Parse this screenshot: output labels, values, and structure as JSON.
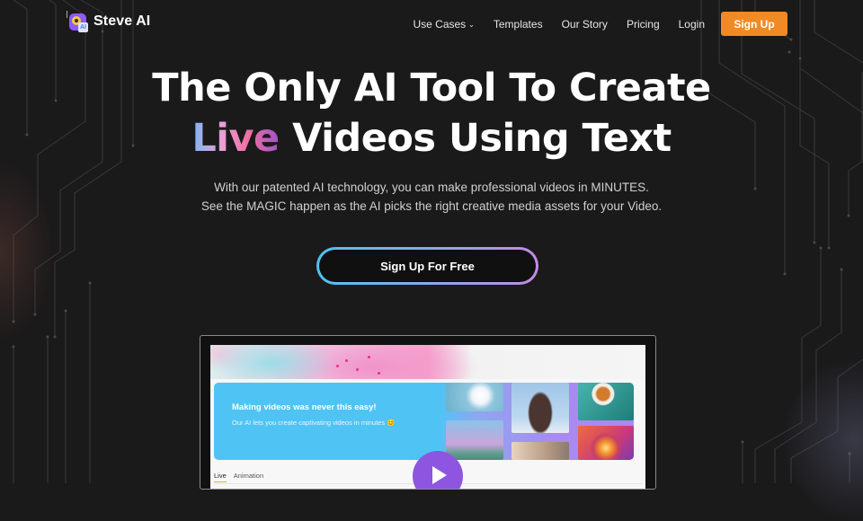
{
  "brand": {
    "name": "Steve AI",
    "logo_badge": "AI"
  },
  "nav": {
    "items": [
      {
        "label": "Use Cases",
        "icon": "chevron-down-icon",
        "has_dropdown": true
      },
      {
        "label": "Templates"
      },
      {
        "label": "Our Story"
      },
      {
        "label": "Pricing"
      },
      {
        "label": "Login"
      }
    ],
    "signup_label": "Sign Up",
    "signup_color": "#f08a24"
  },
  "hero": {
    "headline_line1": "The Only AI Tool To Create",
    "headline_highlight": "Live",
    "headline_line2_rest": "Videos Using Text",
    "subtitle_line1": "With our patented AI technology, you can make professional videos in MINUTES.",
    "subtitle_line2": "See the MAGIC happen as the AI picks the right creative media assets for your Video.",
    "cta_label": "Sign Up For Free",
    "highlight_gradient": [
      "#7bb7f5",
      "#e8a0d4",
      "#f06fa0",
      "#9b55c9"
    ],
    "cta_border_gradient": [
      "#4ec3f0",
      "#8aa8ee",
      "#c38ae6"
    ]
  },
  "preview": {
    "card_title": "Making videos was never this easy!",
    "card_subtitle": "Our AI lets you create captivating videos in minutes 😊",
    "tabs": [
      {
        "label": "Live",
        "active": true
      },
      {
        "label": "Animation",
        "active": false
      }
    ],
    "play_icon": "play-icon",
    "play_color": "#8e56e0",
    "card_color": "#4fc4f4"
  }
}
